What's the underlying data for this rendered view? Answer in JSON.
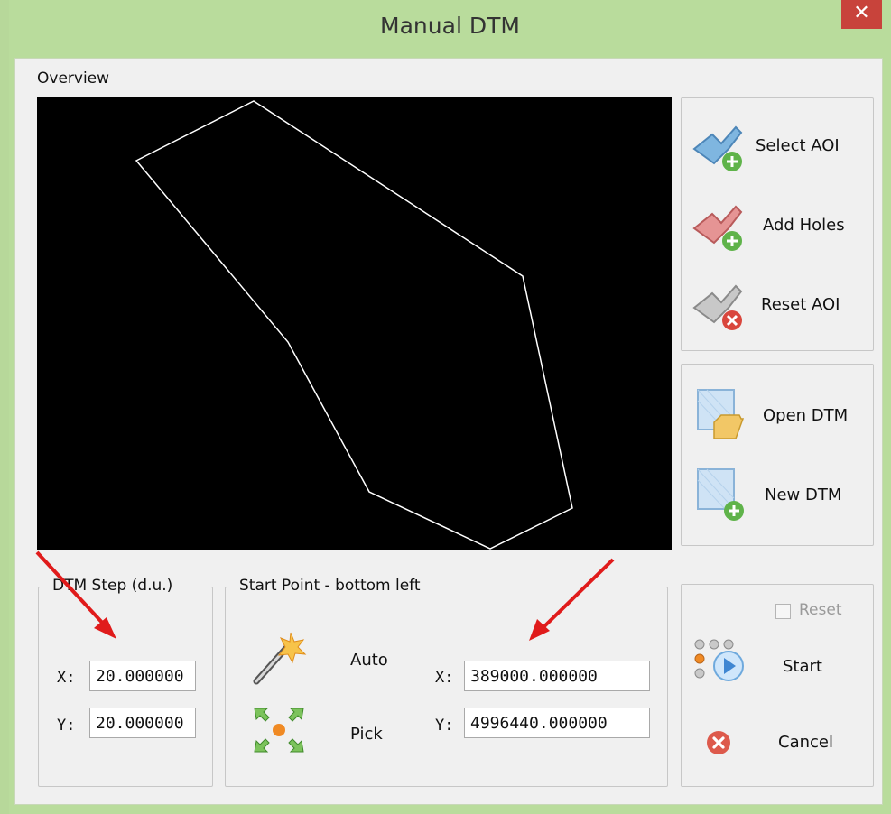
{
  "window": {
    "title": "Manual DTM",
    "close_label": "✕"
  },
  "overview": {
    "label": "Overview"
  },
  "aoi_buttons": [
    {
      "label": "Select AOI",
      "icon": "select-aoi-icon"
    },
    {
      "label": "Add Holes",
      "icon": "add-holes-icon"
    },
    {
      "label": "Reset AOI",
      "icon": "reset-aoi-icon"
    }
  ],
  "dtm_buttons": [
    {
      "label": "Open DTM",
      "icon": "open-dtm-icon"
    },
    {
      "label": "New DTM",
      "icon": "new-dtm-icon"
    }
  ],
  "dtm_step": {
    "title": "DTM Step (d.u.)",
    "x_label": "X:",
    "x_value": "20.000000",
    "y_label": "Y:",
    "y_value": "20.000000"
  },
  "start_point": {
    "title": "Start Point - bottom left",
    "auto_label": "Auto",
    "pick_label": "Pick",
    "x_label": "X:",
    "x_value": "389000.000000",
    "y_label": "Y:",
    "y_value": "4996440.000000"
  },
  "actions": {
    "reset_label": "Reset",
    "reset_checked": false,
    "start_label": "Start",
    "cancel_label": "Cancel"
  },
  "colors": {
    "title_bar": "#b9dc9c",
    "close": "#c8433b",
    "annotation_arrow": "#e01b1b"
  }
}
